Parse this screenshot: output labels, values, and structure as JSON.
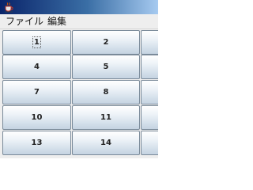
{
  "window": {
    "title": "",
    "icon": "java-cup-icon",
    "title_bar_gradient": [
      "#0a246a",
      "#3a6ea5",
      "#a6caf0"
    ]
  },
  "menu": {
    "file_label": "ファイル",
    "edit_label": "編集"
  },
  "buttons": [
    "1",
    "2",
    "",
    "4",
    "5",
    "",
    "7",
    "8",
    "",
    "10",
    "11",
    "",
    "13",
    "14",
    ""
  ],
  "focused_button": "1",
  "colors": {
    "menu_background": "#eeeeee",
    "button_border": "#7a8a99",
    "button_gradient_top": "#ffffff",
    "button_gradient_bottom": "#c5d3e1"
  }
}
